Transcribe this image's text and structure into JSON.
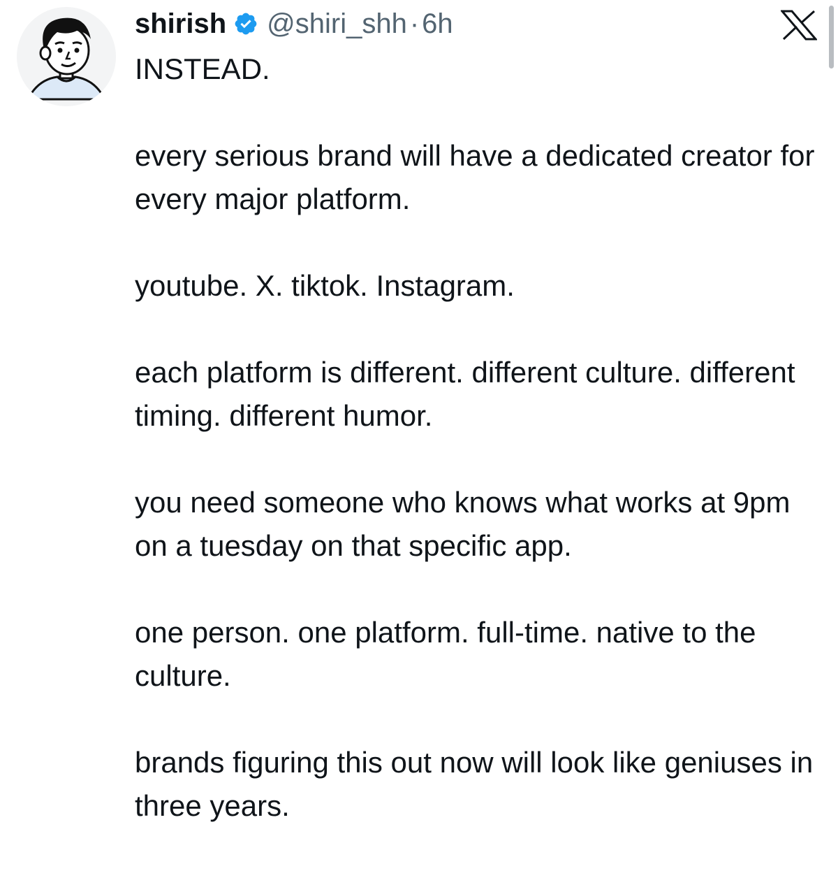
{
  "tweet": {
    "author": {
      "display_name": "shirish",
      "handle": "@shiri_shh",
      "verified": true,
      "avatar_icon": "cartoon-avatar"
    },
    "separator": "·",
    "timestamp": "6h",
    "platform_icon": "x-logo-icon",
    "paragraphs": [
      "INSTEAD.",
      "every serious brand will have a dedicated creator for every major platform.",
      "youtube. X. tiktok. Instagram.",
      "each platform is different. different culture. different timing. different humor.",
      "you need someone who knows what works at 9pm on a tuesday on that specific app.",
      "one person. one platform. full-time. native to the culture.",
      "brands figuring this out now will look like geniuses in three years."
    ]
  },
  "colors": {
    "text": "#0f1419",
    "secondary": "#536471",
    "verified_blue": "#1d9bf0"
  }
}
